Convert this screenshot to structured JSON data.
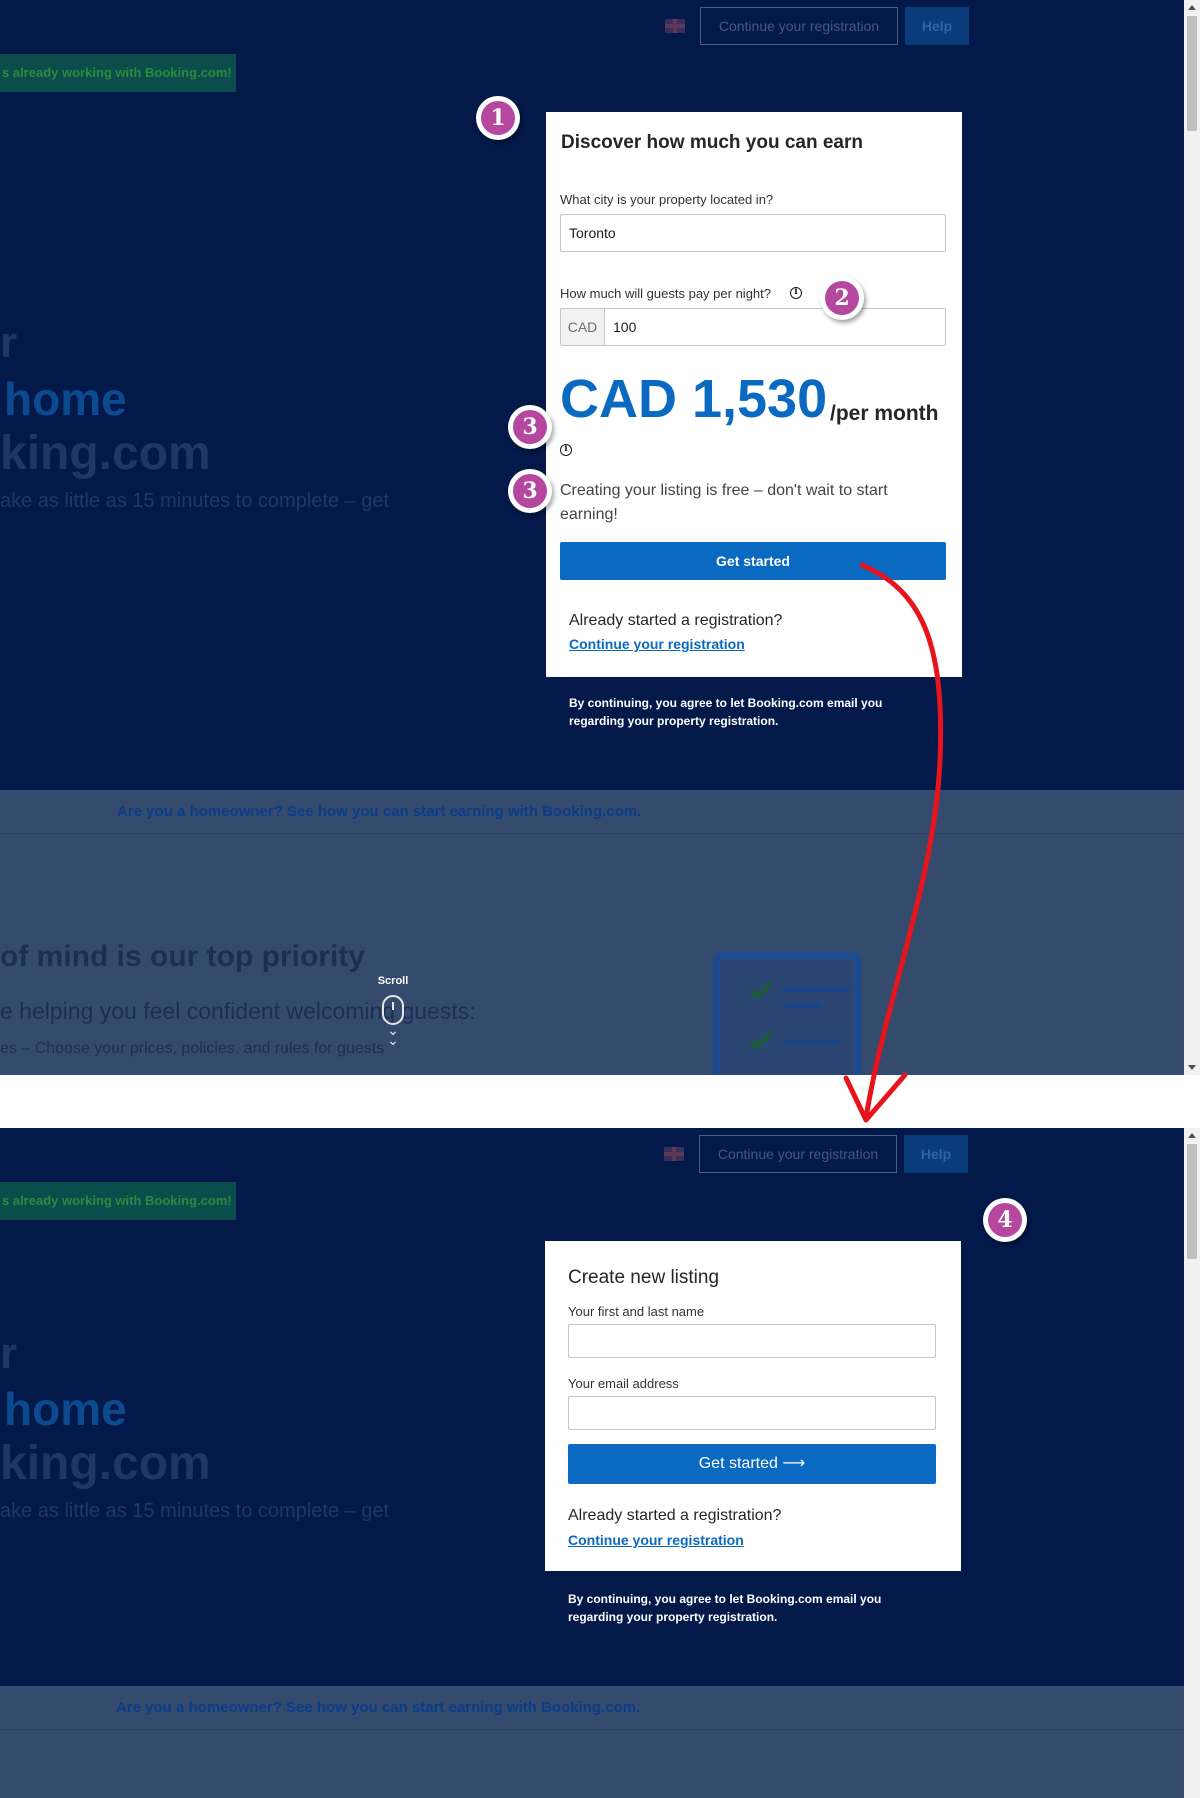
{
  "header": {
    "flag_icon": "uk-flag-icon",
    "continue_label": "Continue your registration",
    "help_label": "Help"
  },
  "banner": {
    "text": "s already working with Booking.com!"
  },
  "hero": {
    "line_1": "r",
    "line_2": "home",
    "line_3": "king.com",
    "subtitle": "ake as little as 15 minutes to complete – get"
  },
  "estimator": {
    "title": "Discover how much you can earn",
    "city_label": "What city is your property located in?",
    "city_value": "Toronto",
    "price_label": "How much will guests pay per night?",
    "currency": "CAD",
    "price_value": "100",
    "amount": "CAD 1,530",
    "period": "/per month",
    "free_text": "Creating your listing is free – don't wait to start earning!",
    "cta_label": "Get started",
    "already_label": "Already started a registration?",
    "continue_link": "Continue your registration"
  },
  "agreement": "By continuing, you agree to let Booking.com email you regarding your property registration.",
  "homeowner_link": "Are you a homeowner? See how you can start earning with Booking.com.",
  "peace": {
    "title": "of mind is our top priority",
    "subtitle": "e helping you feel confident welcoming guests:",
    "bullet": "es – Choose your prices, policies, and rules for guests"
  },
  "scroll_hint": "Scroll",
  "new_listing": {
    "title": "Create new listing",
    "name_label": "Your first and last name",
    "name_value": "",
    "email_label": "Your email address",
    "email_value": "",
    "cta_label": "Get started ⟶",
    "already_label": "Already started a registration?",
    "continue_link": "Continue your registration"
  },
  "badges": [
    "1",
    "2",
    "3",
    "3",
    "4"
  ],
  "colors": {
    "page_overlay": "#03194a",
    "brand_blue": "#0a6ac2",
    "badge_purple": "#b5479e",
    "arrow_red": "#e8141c"
  }
}
